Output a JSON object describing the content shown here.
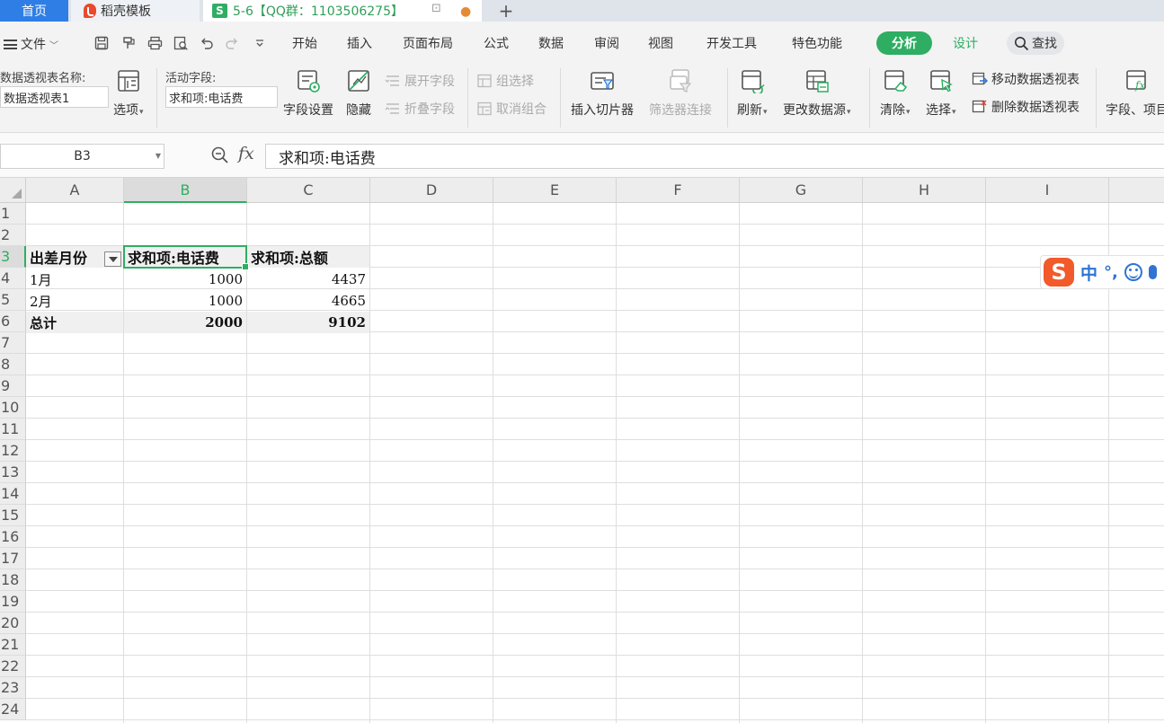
{
  "tabs": {
    "home": "首页",
    "docer": "稻壳模板",
    "file": "5-6【QQ群：1103506275】",
    "file_icon": "S",
    "add": "+"
  },
  "menu": {
    "file": "文件",
    "items": [
      "开始",
      "插入",
      "页面布局",
      "公式",
      "数据",
      "审阅",
      "视图",
      "开发工具",
      "特色功能"
    ],
    "active": "分析",
    "design": "设计",
    "search": "查找"
  },
  "ribbon": {
    "pivot_name_label": "数据透视表名称:",
    "pivot_name_value": "数据透视表1",
    "options": "选项",
    "active_field_label": "活动字段:",
    "active_field_value": "求和项:电话费",
    "field_settings": "字段设置",
    "hide": "隐藏",
    "expand_field": "展开字段",
    "collapse_field": "折叠字段",
    "group_select": "组选择",
    "ungroup": "取消组合",
    "insert_slicer": "插入切片器",
    "filter_connection": "筛选器连接",
    "refresh": "刷新",
    "change_source": "更改数据源",
    "clear": "清除",
    "select": "选择",
    "move_pivot": "移动数据透视表",
    "delete_pivot": "删除数据透视表",
    "fields_items": "字段、项目"
  },
  "formula_bar": {
    "name_box": "B3",
    "fx": "fx",
    "formula": "求和项:电话费"
  },
  "sheet": {
    "columns": [
      "A",
      "B",
      "C",
      "D",
      "E",
      "F",
      "G",
      "H",
      "I"
    ],
    "selected_column": "B",
    "selected_row": "3",
    "rows": [
      "1",
      "2",
      "3",
      "4",
      "5",
      "6",
      "7",
      "8",
      "9",
      "10",
      "11",
      "12",
      "13",
      "14",
      "15",
      "16",
      "17",
      "18",
      "19",
      "20",
      "21",
      "22",
      "23",
      "24"
    ],
    "pivot": {
      "header": [
        "出差月份",
        "求和项:电话费",
        "求和项:总额"
      ],
      "data": [
        [
          "1月",
          "1000",
          "4437"
        ],
        [
          "2月",
          "1000",
          "4665"
        ]
      ],
      "total": [
        "总计",
        "2000",
        "9102"
      ]
    }
  },
  "ime": {
    "logo": "S",
    "mode": "中",
    "punct": "°,"
  },
  "colors": {
    "accent": "#2fae63",
    "home_tab": "#2f7ee6",
    "ime_logo": "#f2592b",
    "ime_text": "#2f74d0"
  }
}
